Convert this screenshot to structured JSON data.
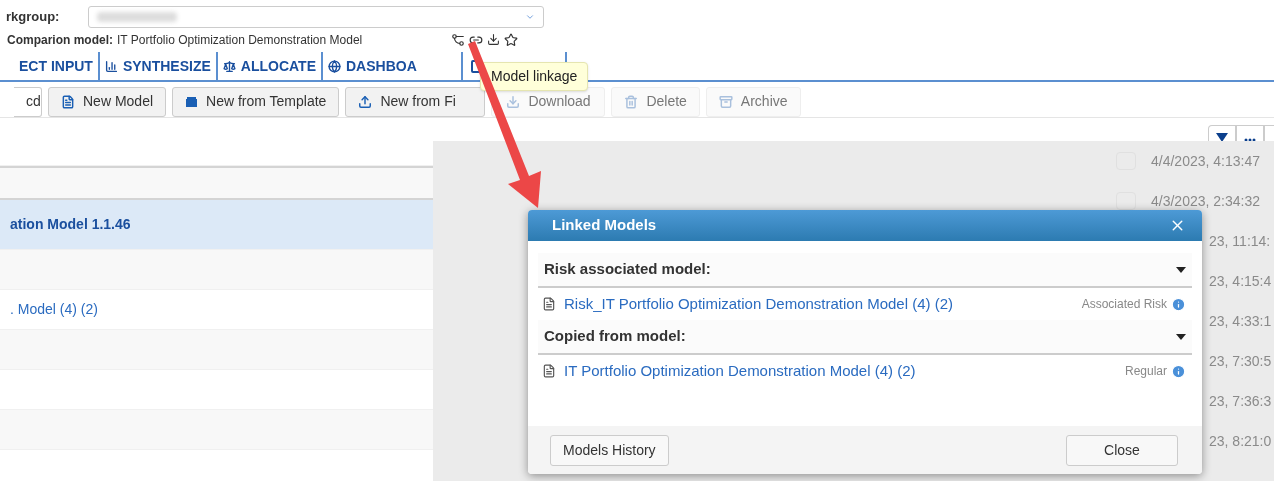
{
  "workgroup": {
    "label": "rkgroup:"
  },
  "comparion_model": {
    "label": "Comparion model:",
    "value": "IT Portfolio Optimization Demonstration Model"
  },
  "tabs": [
    {
      "label": "ECT INPUT",
      "selected": false
    },
    {
      "label": "SYNTHESIZE",
      "selected": false
    },
    {
      "label": "ALLOCATE",
      "selected": false
    },
    {
      "label": "DASHBOA",
      "selected": false
    }
  ],
  "tooltip": "Model linkage",
  "toolbar": [
    {
      "label": "cd",
      "disabled": false
    },
    {
      "label": "New Model",
      "disabled": false
    },
    {
      "label": "New from Template",
      "disabled": false
    },
    {
      "label": "New from Fi",
      "disabled": false
    },
    {
      "label": "Download",
      "disabled": true
    },
    {
      "label": "Delete",
      "disabled": true
    },
    {
      "label": "Archive",
      "disabled": true
    }
  ],
  "list_rows": [
    {
      "text": "",
      "kind": "row",
      "selected": false
    },
    {
      "text": "",
      "kind": "header",
      "selected": false
    },
    {
      "text": "ation Model 1.1.46",
      "kind": "row",
      "selected": true
    },
    {
      "text": "",
      "kind": "row",
      "selected": false
    },
    {
      "text": ". Model (4) (2)",
      "kind": "row",
      "selected": false
    },
    {
      "text": "",
      "kind": "row",
      "selected": false
    },
    {
      "text": "",
      "kind": "row",
      "selected": false
    },
    {
      "text": "",
      "kind": "row",
      "selected": false
    }
  ],
  "dates": [
    {
      "text": "4/4/2023, 4:13:47",
      "covered": false
    },
    {
      "text": "4/3/2023, 2:34:32",
      "covered": false
    },
    {
      "text": "23, 11:14:",
      "covered": true
    },
    {
      "text": "23, 4:15:4",
      "covered": true
    },
    {
      "text": "23, 4:33:1",
      "covered": true
    },
    {
      "text": "23, 7:30:5",
      "covered": true
    },
    {
      "text": "23, 7:36:3",
      "covered": true
    },
    {
      "text": "23, 8:21:0",
      "covered": true
    }
  ],
  "dialog": {
    "title": "Linked Models",
    "sections": [
      {
        "heading": "Risk associated model:",
        "expanded": true,
        "items": [
          {
            "name": "Risk_IT Portfolio Optimization Demonstration Model (4) (2)",
            "type": "Associated Risk"
          }
        ]
      },
      {
        "heading": "Copied from model:",
        "expanded": true,
        "items": [
          {
            "name": "IT Portfolio Optimization Demonstration Model (4) (2)",
            "type": "Regular"
          }
        ]
      }
    ],
    "buttons": [
      "Models History",
      "Close"
    ]
  }
}
